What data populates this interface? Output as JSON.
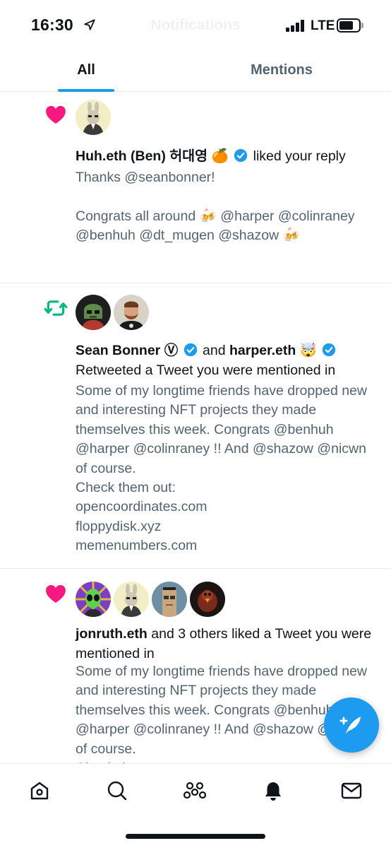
{
  "status_bar": {
    "time": "16:30",
    "network": "LTE",
    "ghost_title": "Notifications",
    "icons": [
      "location-arrow-icon",
      "signal-icon",
      "battery-icon"
    ]
  },
  "tabs": [
    {
      "label": "All",
      "active": true
    },
    {
      "label": "Mentions",
      "active": false
    }
  ],
  "notifications": [
    {
      "type": "like",
      "icon": "heart-icon",
      "actors": [
        "Huh.eth (Ben) 허대영 🍊"
      ],
      "verified": true,
      "actor_name": "Huh.eth (Ben) 허대영 🍊",
      "action": "liked your reply",
      "body": "Thanks @seanbonner!\n\nCongrats all around 🍻 @harper @colinraney @benhuh @dt_mugen @shazow 🍻"
    },
    {
      "type": "retweet",
      "icon": "retweet-icon",
      "actor1": "Sean Bonner Ⓥ",
      "connector": "and",
      "actor2": "harper.eth 🤯",
      "action": "Retweeted a Tweet you were mentioned in",
      "body": "Some of my longtime friends have dropped new and interesting NFT projects they made themselves this week. Congrats @benhuh @harper @colinraney !! And @shazow @nicwn of course.\nCheck them out:\nopencoordinates.com\nfloppydisk.xyz\nmemenumbers.com"
    },
    {
      "type": "like",
      "icon": "heart-icon",
      "actor": "jonruth.eth",
      "action": "and 3 others liked a Tweet you were mentioned in",
      "body": "Some of my longtime friends have dropped new and interesting NFT projects they made themselves this week. Congrats @benhuh @harper @colinraney !! And @shazow @nicwn of course.\nCheck them out:"
    }
  ],
  "bottom_nav": [
    "home-icon",
    "search-icon",
    "spaces-icon",
    "notifications-bell-icon",
    "messages-icon"
  ],
  "fab": {
    "icon": "compose-tweet-icon"
  },
  "colors": {
    "accent": "#1d9bf0",
    "like": "#f91880",
    "retweet": "#00ba7c",
    "secondary_text": "#536471"
  }
}
